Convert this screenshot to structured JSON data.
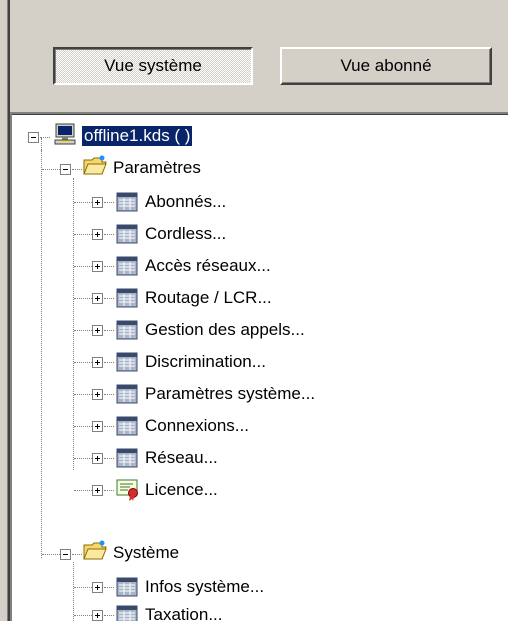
{
  "toolbar": {
    "system_view_label": "Vue système",
    "subscriber_view_label": "Vue abonné"
  },
  "tree": {
    "root": {
      "label": "offline1.kds ( )",
      "icon": "computer-icon"
    },
    "groups": [
      {
        "label": "Paramètres",
        "icon": "folder-icon",
        "items": [
          {
            "label": "Abonnés...",
            "icon": "table-icon"
          },
          {
            "label": "Cordless...",
            "icon": "table-icon"
          },
          {
            "label": "Accès réseaux...",
            "icon": "table-icon"
          },
          {
            "label": "Routage / LCR...",
            "icon": "table-icon"
          },
          {
            "label": "Gestion des appels...",
            "icon": "table-icon"
          },
          {
            "label": "Discrimination...",
            "icon": "table-icon"
          },
          {
            "label": "Paramètres système...",
            "icon": "table-icon"
          },
          {
            "label": "Connexions...",
            "icon": "table-icon"
          },
          {
            "label": "Réseau...",
            "icon": "table-icon"
          },
          {
            "label": "Licence...",
            "icon": "certificate-icon"
          }
        ]
      },
      {
        "label": "Système",
        "icon": "folder-icon",
        "items": [
          {
            "label": "Infos système...",
            "icon": "table-icon"
          },
          {
            "label": "Taxation...",
            "icon": "table-icon"
          }
        ]
      }
    ]
  }
}
